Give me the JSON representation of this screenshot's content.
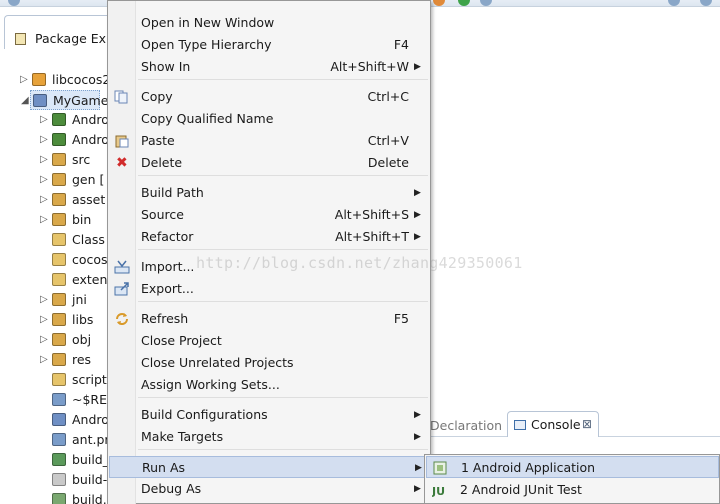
{
  "package_explorer": {
    "tab_title": "Package Explo",
    "rows": [
      {
        "label": "libcocos2",
        "twisty": "▷"
      },
      {
        "label": "MyGame",
        "twisty": "◢"
      },
      {
        "label": "Andro",
        "twisty": "▷"
      },
      {
        "label": "Andro",
        "twisty": "▷"
      },
      {
        "label": "src",
        "twisty": "▷"
      },
      {
        "label": "gen [",
        "twisty": "▷"
      },
      {
        "label": "asset",
        "twisty": "▷"
      },
      {
        "label": "bin",
        "twisty": "▷"
      },
      {
        "label": "Class",
        "twisty": ""
      },
      {
        "label": "cocos",
        "twisty": ""
      },
      {
        "label": "exten",
        "twisty": ""
      },
      {
        "label": "jni",
        "twisty": "▷"
      },
      {
        "label": "libs",
        "twisty": "▷"
      },
      {
        "label": "obj",
        "twisty": "▷"
      },
      {
        "label": "res",
        "twisty": "▷"
      },
      {
        "label": "script",
        "twisty": ""
      },
      {
        "label": "~$RE",
        "twisty": ""
      },
      {
        "label": "Andro",
        "twisty": ""
      },
      {
        "label": "ant.pr",
        "twisty": ""
      },
      {
        "label": "build_",
        "twisty": ""
      },
      {
        "label": "build-",
        "twisty": ""
      },
      {
        "label": "build.",
        "twisty": ""
      }
    ]
  },
  "context_menu": {
    "items": [
      {
        "label": "Open in New Window",
        "shortcut": "",
        "arrow": ""
      },
      {
        "label": "Open Type Hierarchy",
        "shortcut": "F4",
        "arrow": ""
      },
      {
        "label": "Show In",
        "shortcut": "Alt+Shift+W",
        "arrow": "▶"
      },
      {
        "label": "Copy",
        "shortcut": "Ctrl+C",
        "arrow": ""
      },
      {
        "label": "Copy Qualified Name",
        "shortcut": "",
        "arrow": ""
      },
      {
        "label": "Paste",
        "shortcut": "Ctrl+V",
        "arrow": ""
      },
      {
        "label": "Delete",
        "shortcut": "Delete",
        "arrow": ""
      },
      {
        "label": "Build Path",
        "shortcut": "",
        "arrow": "▶"
      },
      {
        "label": "Source",
        "shortcut": "Alt+Shift+S",
        "arrow": "▶"
      },
      {
        "label": "Refactor",
        "shortcut": "Alt+Shift+T",
        "arrow": "▶"
      },
      {
        "label": "Import...",
        "shortcut": "",
        "arrow": ""
      },
      {
        "label": "Export...",
        "shortcut": "",
        "arrow": ""
      },
      {
        "label": "Refresh",
        "shortcut": "F5",
        "arrow": ""
      },
      {
        "label": "Close Project",
        "shortcut": "",
        "arrow": ""
      },
      {
        "label": "Close Unrelated Projects",
        "shortcut": "",
        "arrow": ""
      },
      {
        "label": "Assign Working Sets...",
        "shortcut": "",
        "arrow": ""
      },
      {
        "label": "Build Configurations",
        "shortcut": "",
        "arrow": "▶"
      },
      {
        "label": "Make Targets",
        "shortcut": "",
        "arrow": "▶"
      },
      {
        "label": "Run As",
        "shortcut": "",
        "arrow": "▶"
      },
      {
        "label": "Debug As",
        "shortcut": "",
        "arrow": "▶"
      }
    ],
    "delete_icon_glyph": "✖",
    "highlight_color": "#d3def0"
  },
  "run_as_submenu": {
    "items": [
      {
        "label": "1 Android Application"
      },
      {
        "label": "2 Android JUnit Test"
      }
    ],
    "junit_icon_text": "JU"
  },
  "bottom_tabs": {
    "declaration": "Declaration",
    "console": "Console",
    "close_glyph": "⊠"
  },
  "watermark": "http://blog.csdn.net/zhang429350061"
}
